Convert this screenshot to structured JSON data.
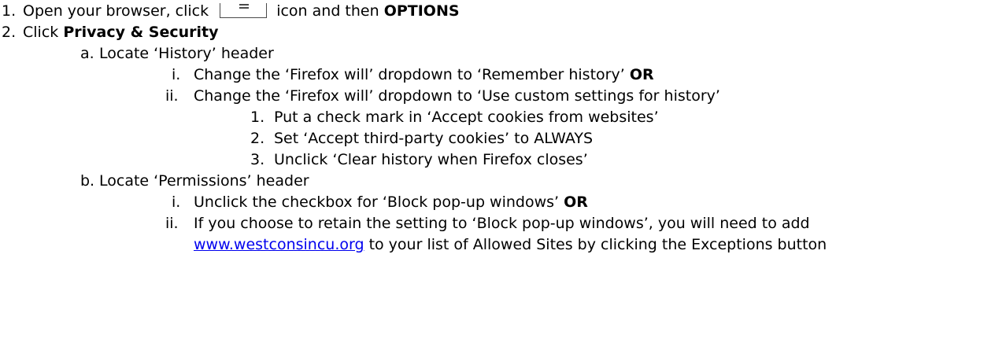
{
  "steps": {
    "s1": {
      "num": "1.",
      "pre": "Open your browser, click",
      "icon": "hamburger-menu-icon",
      "mid": "icon and then",
      "bold": "OPTIONS"
    },
    "s2": {
      "num": "2.",
      "pre": "Click",
      "bold": "Privacy & Security"
    },
    "a": {
      "num": "a.",
      "text": "Locate ‘History’ header"
    },
    "a_i": {
      "num": "i.",
      "text": "Change the ‘Firefox will’ dropdown to ‘Remember history’",
      "bold": "OR"
    },
    "a_ii": {
      "num": "ii.",
      "text": "Change the ‘Firefox will’ dropdown to ‘Use custom settings for history’"
    },
    "a_ii_1": {
      "num": "1.",
      "text": "Put a check mark in ‘Accept cookies from websites’"
    },
    "a_ii_2": {
      "num": "2.",
      "text": "Set ‘Accept third-party cookies’ to ALWAYS"
    },
    "a_ii_3": {
      "num": "3.",
      "text": "Unclick ‘Clear history when Firefox closes’"
    },
    "b": {
      "num": "b.",
      "text": "Locate ‘Permissions’ header"
    },
    "b_i": {
      "num": "i.",
      "text": "Unclick the checkbox for ‘Block pop-up windows’",
      "bold": "OR"
    },
    "b_ii": {
      "num": "ii.",
      "text": "If you choose to retain the setting to ‘Block pop-up windows’, you will need to add",
      "link": "www.westconsincu.org",
      "tail": "to your list of Allowed Sites by clicking the Exceptions button"
    }
  }
}
